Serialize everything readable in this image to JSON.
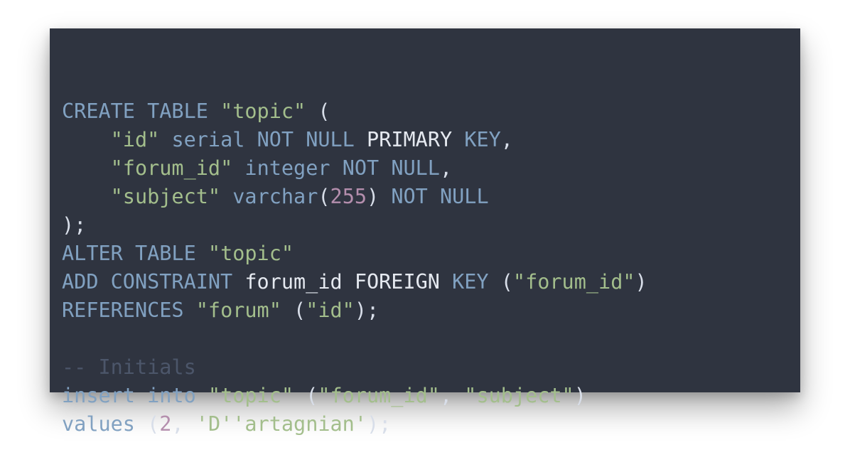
{
  "colors": {
    "background": "#2f3440",
    "keyword": "#81a1c1",
    "string": "#a3be8c",
    "number": "#b48ead",
    "identifier": "#e5e9f0",
    "punctuation": "#d8dee9",
    "comment": "#4c566a"
  },
  "code": {
    "lines": [
      [
        {
          "t": "CREATE TABLE",
          "c": "kw"
        },
        {
          "t": " ",
          "c": "punct"
        },
        {
          "t": "\"topic\"",
          "c": "str"
        },
        {
          "t": " (",
          "c": "punct"
        }
      ],
      [
        {
          "t": "    ",
          "c": "punct"
        },
        {
          "t": "\"id\"",
          "c": "str"
        },
        {
          "t": " ",
          "c": "punct"
        },
        {
          "t": "serial",
          "c": "kw"
        },
        {
          "t": " ",
          "c": "punct"
        },
        {
          "t": "NOT NULL",
          "c": "kw"
        },
        {
          "t": " ",
          "c": "punct"
        },
        {
          "t": "PRIMARY",
          "c": "ident"
        },
        {
          "t": " ",
          "c": "punct"
        },
        {
          "t": "KEY",
          "c": "kw"
        },
        {
          "t": ",",
          "c": "punct"
        }
      ],
      [
        {
          "t": "    ",
          "c": "punct"
        },
        {
          "t": "\"forum_id\"",
          "c": "str"
        },
        {
          "t": " ",
          "c": "punct"
        },
        {
          "t": "integer",
          "c": "kw"
        },
        {
          "t": " ",
          "c": "punct"
        },
        {
          "t": "NOT NULL",
          "c": "kw"
        },
        {
          "t": ",",
          "c": "punct"
        }
      ],
      [
        {
          "t": "    ",
          "c": "punct"
        },
        {
          "t": "\"subject\"",
          "c": "str"
        },
        {
          "t": " ",
          "c": "punct"
        },
        {
          "t": "varchar",
          "c": "kw"
        },
        {
          "t": "(",
          "c": "punct"
        },
        {
          "t": "255",
          "c": "num"
        },
        {
          "t": ") ",
          "c": "punct"
        },
        {
          "t": "NOT NULL",
          "c": "kw"
        }
      ],
      [
        {
          "t": ");",
          "c": "punct"
        }
      ],
      [
        {
          "t": "ALTER TABLE",
          "c": "kw"
        },
        {
          "t": " ",
          "c": "punct"
        },
        {
          "t": "\"topic\"",
          "c": "str"
        }
      ],
      [
        {
          "t": "ADD CONSTRAINT",
          "c": "kw"
        },
        {
          "t": " ",
          "c": "punct"
        },
        {
          "t": "forum_id FOREIGN",
          "c": "ident"
        },
        {
          "t": " ",
          "c": "punct"
        },
        {
          "t": "KEY",
          "c": "kw"
        },
        {
          "t": " (",
          "c": "punct"
        },
        {
          "t": "\"forum_id\"",
          "c": "str"
        },
        {
          "t": ")",
          "c": "punct"
        }
      ],
      [
        {
          "t": "REFERENCES",
          "c": "kw"
        },
        {
          "t": " ",
          "c": "punct"
        },
        {
          "t": "\"forum\"",
          "c": "str"
        },
        {
          "t": " (",
          "c": "punct"
        },
        {
          "t": "\"id\"",
          "c": "str"
        },
        {
          "t": ");",
          "c": "punct"
        }
      ],
      [],
      [
        {
          "t": "-- Initials",
          "c": "comment"
        }
      ],
      [
        {
          "t": "insert into",
          "c": "kw"
        },
        {
          "t": " ",
          "c": "punct"
        },
        {
          "t": "\"topic\"",
          "c": "str"
        },
        {
          "t": " (",
          "c": "punct"
        },
        {
          "t": "\"forum_id\"",
          "c": "str"
        },
        {
          "t": ", ",
          "c": "punct"
        },
        {
          "t": "\"subject\"",
          "c": "str"
        },
        {
          "t": ")",
          "c": "punct"
        }
      ],
      [
        {
          "t": "values",
          "c": "kw"
        },
        {
          "t": " (",
          "c": "punct"
        },
        {
          "t": "2",
          "c": "num"
        },
        {
          "t": ", ",
          "c": "punct"
        },
        {
          "t": "'D''artagnian'",
          "c": "str"
        },
        {
          "t": ");",
          "c": "punct"
        }
      ]
    ]
  }
}
